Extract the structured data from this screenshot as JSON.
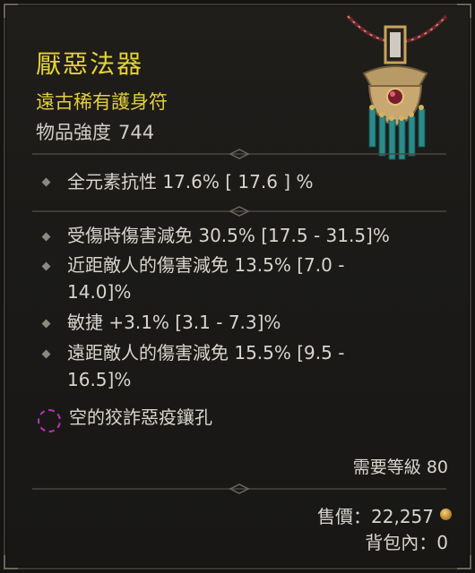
{
  "item": {
    "name": "厭惡法器",
    "rarity": "遠古稀有護身符",
    "power_label": "物品強度",
    "power_value": "744"
  },
  "implicit": [
    "全元素抗性 17.6%   [ 17.6 ] %"
  ],
  "affixes": [
    {
      "line1": "受傷時傷害減免 30.5% [17.5 - 31.5]%",
      "line2": ""
    },
    {
      "line1": "近距敵人的傷害減免 13.5% [7.0 -",
      "line2": "14.0]%"
    },
    {
      "line1": "敏捷 +3.1% [3.1 - 7.3]%",
      "line2": ""
    },
    {
      "line1": "遠距敵人的傷害減免 15.5% [9.5 -",
      "line2": "16.5]%"
    }
  ],
  "socket": {
    "label": "空的狡詐惡疫鑲孔",
    "icon": "empty-socket-icon",
    "color": "#b534b8"
  },
  "requirement": {
    "label": "需要等級",
    "value": "80"
  },
  "sell": {
    "label": "售價：22,257",
    "icon": "gold-coin-icon"
  },
  "bag": {
    "label": "背包內：0"
  },
  "colors": {
    "title": "#e4d23a",
    "rarity": "#e2cf3c",
    "text": "#d9d5cd",
    "panel": "#1d1c19"
  }
}
